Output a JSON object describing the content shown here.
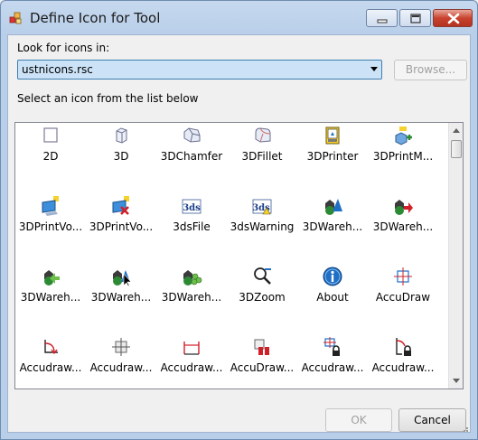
{
  "window": {
    "title": "Define Icon for Tool"
  },
  "form": {
    "look_label": "Look for icons in:",
    "combo_value": "ustnicons.rsc",
    "browse_label": "Browse...",
    "list_label": "Select an icon from the list below",
    "ok_label": "OK",
    "cancel_label": "Cancel"
  },
  "icons": [
    {
      "label": "2D",
      "icon": "square-2d-icon"
    },
    {
      "label": "3D",
      "icon": "cube-3d-icon"
    },
    {
      "label": "3DChamfer",
      "icon": "chamfer-icon"
    },
    {
      "label": "3DFillet",
      "icon": "fillet-icon"
    },
    {
      "label": "3DPrinter",
      "icon": "printer-3d-icon"
    },
    {
      "label": "3DPrintM...",
      "icon": "print-model-add-icon"
    },
    {
      "label": "3DPrintVo...",
      "icon": "print-volume-icon"
    },
    {
      "label": "3DPrintVo...",
      "icon": "print-volume-delete-icon"
    },
    {
      "label": "3dsFile",
      "icon": "3ds-file-icon"
    },
    {
      "label": "3dsWarning",
      "icon": "3ds-warning-icon"
    },
    {
      "label": "3DWareh...",
      "icon": "warehouse-icon"
    },
    {
      "label": "3DWareh...",
      "icon": "warehouse-upload-icon"
    },
    {
      "label": "3DWareh...",
      "icon": "warehouse-download-icon"
    },
    {
      "label": "3DWareh...",
      "icon": "warehouse-select-icon"
    },
    {
      "label": "3DWareh...",
      "icon": "warehouse-components-icon"
    },
    {
      "label": "3DZoom",
      "icon": "zoom-3d-icon"
    },
    {
      "label": "About",
      "icon": "info-icon"
    },
    {
      "label": "AccuDraw",
      "icon": "accudraw-icon"
    },
    {
      "label": "Accudraw...",
      "icon": "accudraw-rotate-icon"
    },
    {
      "label": "Accudraw...",
      "icon": "accudraw-target-icon"
    },
    {
      "label": "Accudraw...",
      "icon": "accudraw-distance-icon"
    },
    {
      "label": "AccuDraw...",
      "icon": "accudraw-bar-icon"
    },
    {
      "label": "Accudraw...",
      "icon": "accudraw-lock-icon"
    },
    {
      "label": "Accudraw...",
      "icon": "accudraw-angle-lock-icon"
    }
  ],
  "colors": {
    "title_gradient": "#c5d8ee",
    "combo_selected": "#cce3f7",
    "accent_blue": "#1f6fc5",
    "warning_yellow": "#f6d22e",
    "delete_red": "#d0202a",
    "warehouse_green": "#2d8a34"
  }
}
